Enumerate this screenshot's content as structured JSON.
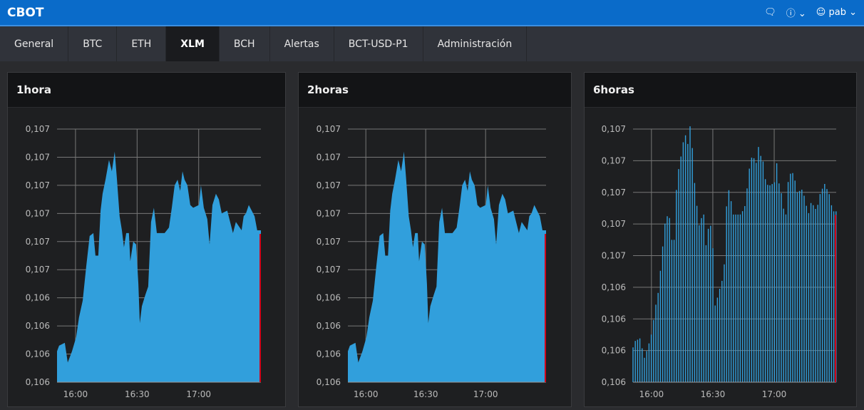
{
  "header": {
    "brand": "CBOT",
    "user": "pab",
    "icons": [
      "chat-icon",
      "help-icon",
      "user-icon"
    ]
  },
  "nav": {
    "tabs": [
      "General",
      "BTC",
      "ETH",
      "XLM",
      "BCH",
      "Alertas",
      "BCT-USD-P1",
      "Administración"
    ],
    "active": "XLM"
  },
  "colors": {
    "area": "#319fdc",
    "cursor": "#d0021b",
    "header": "#0a6bc9"
  },
  "chart_data": [
    {
      "type": "area",
      "title": "1hora",
      "x_unit": "minutes from 16:00",
      "xticks": [
        {
          "v": 0,
          "label": "16:00"
        },
        {
          "v": 30,
          "label": "16:30"
        },
        {
          "v": 60,
          "label": "17:00"
        }
      ],
      "ylim": [
        0.1062,
        0.1071
      ],
      "yticks": [
        "0,107",
        "0,107",
        "0,107",
        "0,107",
        "0,107",
        "0,107",
        "0,106",
        "0,106",
        "0,106",
        "0,106"
      ]
    },
    {
      "type": "area",
      "title": "2horas",
      "x_unit": "minutes from 16:00",
      "xticks": [
        {
          "v": 0,
          "label": "16:00"
        },
        {
          "v": 30,
          "label": "16:30"
        },
        {
          "v": 60,
          "label": "17:00"
        }
      ],
      "ylim": [
        0.1062,
        0.1071
      ],
      "yticks": [
        "0,107",
        "0,107",
        "0,107",
        "0,107",
        "0,107",
        "0,107",
        "0,106",
        "0,106",
        "0,106",
        "0,106"
      ]
    },
    {
      "type": "bar",
      "title": "6horas",
      "x_unit": "minutes from 16:00",
      "xticks": [
        {
          "v": 0,
          "label": "16:00"
        },
        {
          "v": 30,
          "label": "16:30"
        },
        {
          "v": 60,
          "label": "17:00"
        }
      ],
      "ylim": [
        0.1062,
        0.107
      ],
      "yticks": [
        "0,107",
        "0,107",
        "0,107",
        "0,107",
        "0,107",
        "0,106",
        "0,106",
        "0,106",
        "0,106"
      ]
    }
  ],
  "series": {
    "x": [
      -9,
      -8,
      -5.2,
      -3.8,
      -1.7,
      0.3,
      1.7,
      3.5,
      5.2,
      6.9,
      8.7,
      9.7,
      11.1,
      12.2,
      13.2,
      14.6,
      16.3,
      17.7,
      19.1,
      20.1,
      21.5,
      22.6,
      23.6,
      24.7,
      26,
      26.7,
      28.1,
      29.5,
      30.6,
      31.3,
      32.3,
      34,
      35.4,
      36.8,
      38.2,
      39.6,
      43.4,
      45.5,
      46.9,
      48.3,
      49.7,
      51,
      52.1,
      53.1,
      54.5,
      55.9,
      57.3,
      60.1,
      61.1,
      62.5,
      64.2,
      65.3,
      66.7,
      68.4,
      69.8,
      71.2,
      73.9,
      75.3,
      76.7,
      78.1,
      80.9,
      81.9,
      83,
      84.4,
      87.2,
      88.5,
      90.3
    ],
    "y": [
      0.10631,
      0.10633,
      0.10634,
      0.10627,
      0.10631,
      0.10636,
      0.10643,
      0.10649,
      0.10661,
      0.10672,
      0.10673,
      0.10665,
      0.10665,
      0.10681,
      0.10687,
      0.10692,
      0.10699,
      0.10695,
      0.10702,
      0.10693,
      0.10679,
      0.10674,
      0.10668,
      0.10673,
      0.10673,
      0.10663,
      0.1067,
      0.10669,
      0.10655,
      0.10641,
      0.10647,
      0.10651,
      0.10654,
      0.10677,
      0.10682,
      0.10673,
      0.10673,
      0.10675,
      0.10682,
      0.1069,
      0.10692,
      0.10688,
      0.10695,
      0.10692,
      0.1069,
      0.10683,
      0.10682,
      0.10683,
      0.1069,
      0.10682,
      0.10678,
      0.10669,
      0.10683,
      0.10687,
      0.10685,
      0.1068,
      0.10681,
      0.10677,
      0.10673,
      0.10677,
      0.10674,
      0.10679,
      0.1068,
      0.10683,
      0.10679,
      0.10674,
      0.10674
    ]
  }
}
